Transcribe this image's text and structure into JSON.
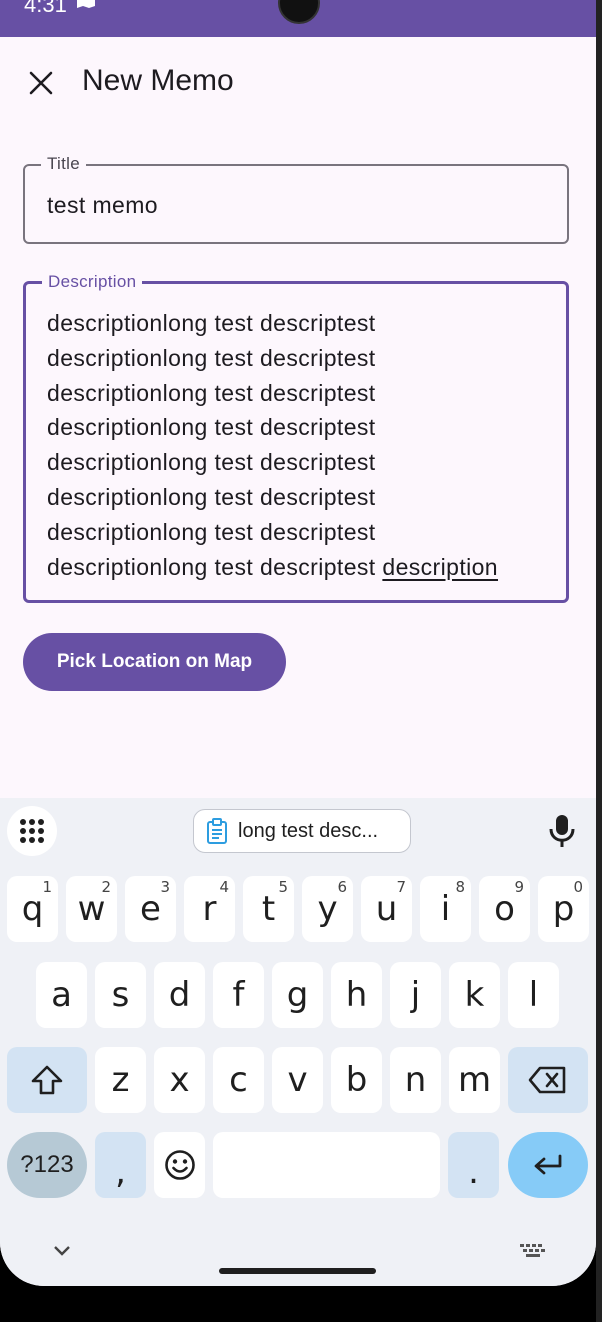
{
  "status_bar": {
    "time": "4:31",
    "bg_color": "#6750a4"
  },
  "top_bar": {
    "title": "New Memo",
    "close_icon": "close-icon"
  },
  "form": {
    "title_field": {
      "label": "Title",
      "value": "test memo"
    },
    "description_field": {
      "label": "Description",
      "lines": [
        "descriptionlong test descriptest",
        "descriptionlong test descriptest",
        "descriptionlong test descriptest",
        "descriptionlong test descriptest",
        "descriptionlong test descriptest",
        "descriptionlong test descriptest",
        "descriptionlong test descriptest"
      ],
      "last_line_prefix": "descriptionlong test descriptest ",
      "composing_word": "description"
    },
    "pick_location_button": "Pick Location on Map"
  },
  "keyboard": {
    "clipboard_suggestion": "long test desc...",
    "row1": [
      {
        "k": "q",
        "h": "1"
      },
      {
        "k": "w",
        "h": "2"
      },
      {
        "k": "e",
        "h": "3"
      },
      {
        "k": "r",
        "h": "4"
      },
      {
        "k": "t",
        "h": "5"
      },
      {
        "k": "y",
        "h": "6"
      },
      {
        "k": "u",
        "h": "7"
      },
      {
        "k": "i",
        "h": "8"
      },
      {
        "k": "o",
        "h": "9"
      },
      {
        "k": "p",
        "h": "0"
      }
    ],
    "row2": [
      "a",
      "s",
      "d",
      "f",
      "g",
      "h",
      "j",
      "k",
      "l"
    ],
    "row3": [
      "z",
      "x",
      "c",
      "v",
      "b",
      "n",
      "m"
    ],
    "symbols_key": "?123",
    "comma_key": ",",
    "period_key": ".",
    "colors": {
      "accent": "#6750a4",
      "key_bg": "#ffffff",
      "mod_key_bg": "#d3e3f3",
      "enter_bg": "#86cbf7"
    }
  }
}
